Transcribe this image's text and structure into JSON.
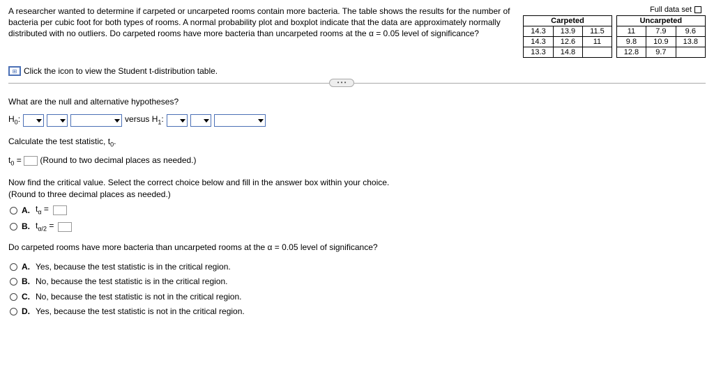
{
  "intro": "A researcher wanted to determine if carpeted or uncarpeted rooms contain more bacteria. The table shows the results for the number of bacteria per cubic foot for both types of rooms. A normal probability plot and boxplot indicate that the data are approximately normally distributed with no outliers. Do carpeted rooms have more bacteria than uncarpeted rooms at the α = 0.05 level of significance?",
  "full_data_link": "Full data set",
  "tables": {
    "carpeted": {
      "header": "Carpeted",
      "rows": [
        [
          "14.3",
          "13.9",
          "11.5"
        ],
        [
          "14.3",
          "12.6",
          "11"
        ],
        [
          "13.3",
          "14.8",
          ""
        ]
      ]
    },
    "uncarpeted": {
      "header": "Uncarpeted",
      "rows": [
        [
          "11",
          "7.9",
          "9.6"
        ],
        [
          "9.8",
          "10.9",
          "13.8"
        ],
        [
          "12.8",
          "9.7",
          ""
        ]
      ]
    }
  },
  "tdist_link": "Click the icon to view the Student t-distribution table.",
  "questions": {
    "q1_prompt": "What are the null and alternative hypotheses?",
    "h0_label": "H",
    "h0_sub": "0",
    "h1_label": "versus H",
    "h1_sub": "1",
    "q2_prompt_a": "Calculate the test statistic, t",
    "q2_prompt_a_sub": "0",
    "t0_label_a": "t",
    "t0_label_sub": "0",
    "t0_equals": " = ",
    "t0_hint": "(Round to two decimal places as needed.)",
    "q3_prompt_line1": "Now find the critical value. Select the correct choice below and fill in the answer box within your choice.",
    "q3_prompt_line2": "(Round to three decimal places as needed.)",
    "crit_choices": {
      "A": {
        "label_a": "t",
        "label_sub": "α",
        "equals": " = "
      },
      "B": {
        "label_a": "t",
        "label_sub": "α/2",
        "equals": " = "
      }
    },
    "q4_prompt": "Do carpeted rooms have more bacteria than uncarpeted rooms at the α = 0.05 level of significance?",
    "final_choices": {
      "A": "Yes, because the test statistic is in the critical region.",
      "B": "No, because the test statistic is in the critical region.",
      "C": "No, because the test statistic is not in the critical region.",
      "D": "Yes, because the test statistic is not in the critical region."
    }
  },
  "letters": {
    "A": "A.",
    "B": "B.",
    "C": "C.",
    "D": "D."
  }
}
